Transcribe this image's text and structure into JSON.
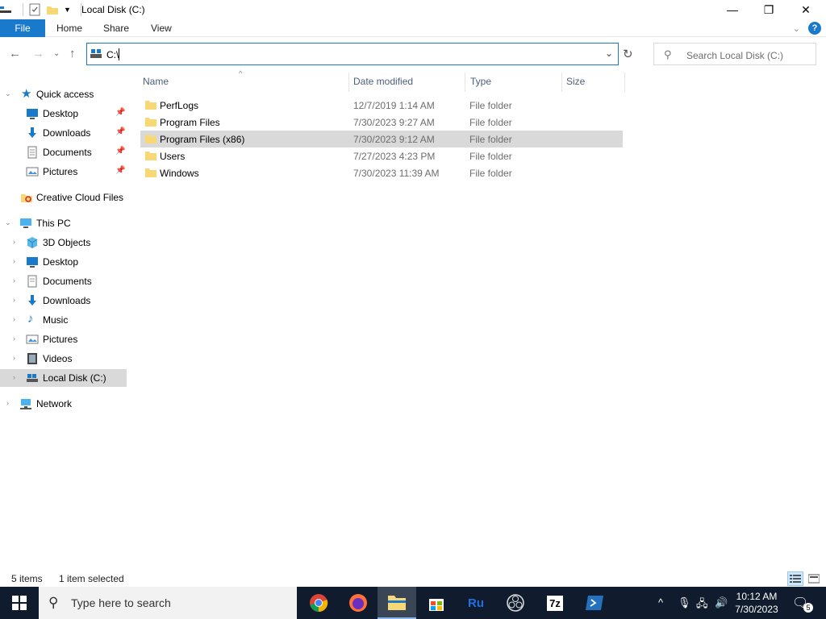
{
  "window": {
    "title": "Local Disk (C:)",
    "minimize_glyph": "—",
    "restore_glyph": "❐",
    "close_glyph": "✕"
  },
  "ribbon": {
    "tabs": [
      "File",
      "Home",
      "Share",
      "View"
    ],
    "accent": "#1979ca"
  },
  "nav": {
    "address_value": "C:\\",
    "search_placeholder": "Search Local Disk (C:)"
  },
  "sidebar": {
    "items": [
      {
        "label": "Quick access",
        "icon": "star-icon",
        "pinned": false
      },
      {
        "label": "Desktop",
        "icon": "desktop-icon",
        "pinned": true
      },
      {
        "label": "Downloads",
        "icon": "download-icon",
        "pinned": true
      },
      {
        "label": "Documents",
        "icon": "documents-icon",
        "pinned": true
      },
      {
        "label": "Pictures",
        "icon": "pictures-icon",
        "pinned": true
      },
      {
        "label": "Creative Cloud Files",
        "icon": "creative-cloud-icon",
        "pinned": false
      },
      {
        "label": "This PC",
        "icon": "computer-icon",
        "pinned": false
      },
      {
        "label": "3D Objects",
        "icon": "cube-icon",
        "pinned": false
      },
      {
        "label": "Desktop",
        "icon": "desktop-icon",
        "pinned": false
      },
      {
        "label": "Documents",
        "icon": "documents-icon",
        "pinned": false
      },
      {
        "label": "Downloads",
        "icon": "download-icon",
        "pinned": false
      },
      {
        "label": "Music",
        "icon": "music-icon",
        "pinned": false
      },
      {
        "label": "Pictures",
        "icon": "pictures-icon",
        "pinned": false
      },
      {
        "label": "Videos",
        "icon": "video-icon",
        "pinned": false
      },
      {
        "label": "Local Disk (C:)",
        "icon": "drive-icon",
        "pinned": false,
        "selected": true
      },
      {
        "label": "Network",
        "icon": "network-icon",
        "pinned": false
      }
    ]
  },
  "files": {
    "columns": [
      "Name",
      "Date modified",
      "Type",
      "Size"
    ],
    "rows": [
      {
        "name": "PerfLogs",
        "date": "12/7/2019 1:14 AM",
        "type": "File folder"
      },
      {
        "name": "Program Files",
        "date": "7/30/2023 9:27 AM",
        "type": "File folder"
      },
      {
        "name": "Program Files (x86)",
        "date": "7/30/2023 9:12 AM",
        "type": "File folder",
        "selected": true
      },
      {
        "name": "Users",
        "date": "7/27/2023 4:23 PM",
        "type": "File folder"
      },
      {
        "name": "Windows",
        "date": "7/30/2023 11:39 AM",
        "type": "File folder"
      }
    ]
  },
  "status": {
    "count": "5 items",
    "selection": "1 item selected"
  },
  "taskbar": {
    "search_placeholder": "Type here to search",
    "apps": [
      "chrome-icon",
      "firefox-icon",
      "file-explorer-icon",
      "store-icon",
      "ru-app-icon",
      "obs-icon",
      "7zip-icon",
      "powershell-icon"
    ],
    "ru_label": "Ru",
    "sevenzip_label": "7z",
    "time": "10:12 AM",
    "date": "7/30/2023",
    "notification_count": "5"
  }
}
